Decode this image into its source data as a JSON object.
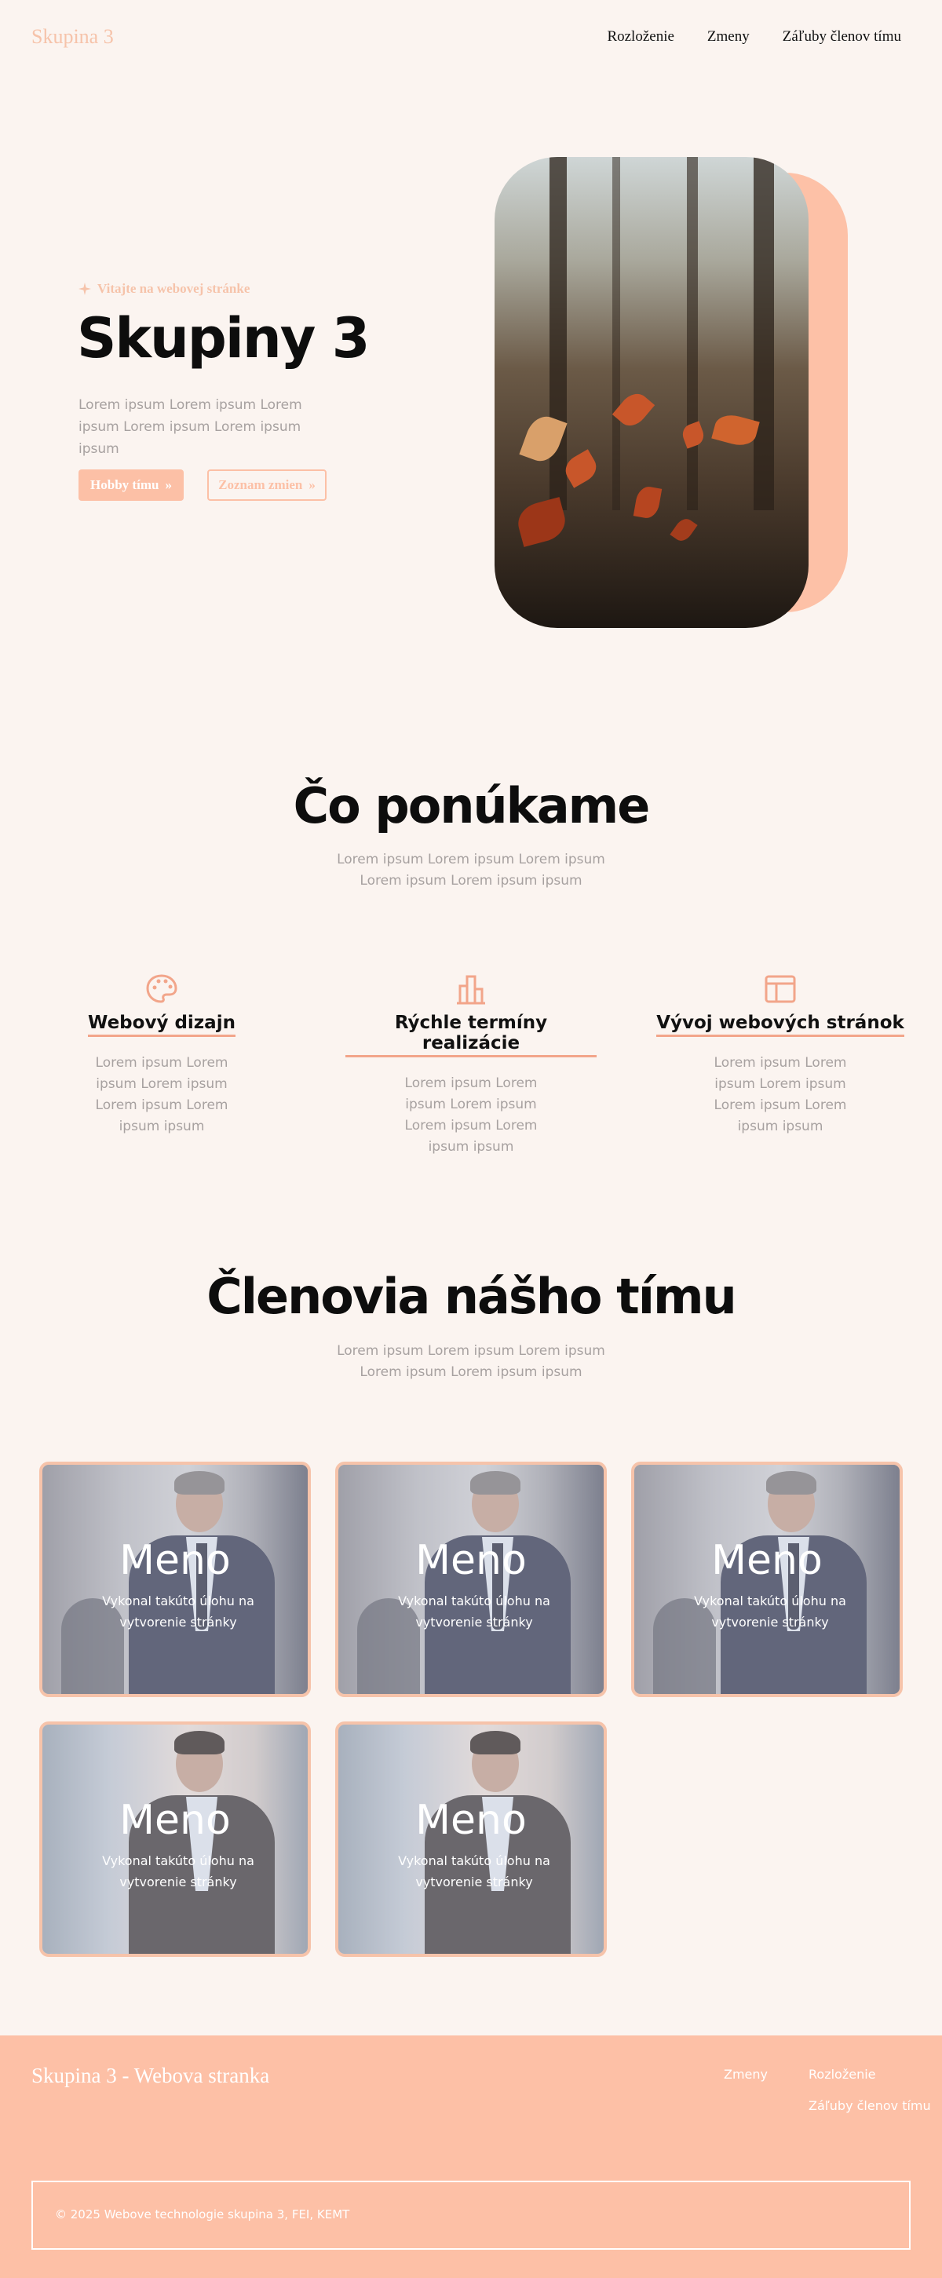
{
  "nav": {
    "logo": "Skupina 3",
    "links": [
      "Rozloženie",
      "Zmeny",
      "Záľuby členov tímu"
    ]
  },
  "hero": {
    "eyebrow": "Vitajte na webovej stránke",
    "title": "Skupiny 3",
    "text": "Lorem ipsum Lorem ipsum Lorem ipsum Lorem ipsum Lorem ipsum ipsum",
    "primary_button": "Hobby tímu",
    "secondary_button": "Zoznam zmien",
    "accent_color": "#fcc0a6"
  },
  "offer": {
    "title": "Čo ponúkame",
    "subtitle": "Lorem ipsum Lorem ipsum Lorem ipsum Lorem ipsum Lorem ipsum ipsum",
    "features": [
      {
        "icon": "palette-icon",
        "title": "Webový dizajn",
        "text": "Lorem ipsum Lorem ipsum Lorem ipsum Lorem ipsum Lorem ipsum ipsum"
      },
      {
        "icon": "buildings-icon",
        "title": "Rýchle termíny realizácie",
        "text": "Lorem ipsum Lorem ipsum Lorem ipsum Lorem ipsum Lorem ipsum ipsum"
      },
      {
        "icon": "layout-icon",
        "title": "Vývoj webových stránok",
        "text": "Lorem ipsum Lorem ipsum Lorem ipsum Lorem ipsum Lorem ipsum ipsum"
      }
    ]
  },
  "team": {
    "title": "Členovia nášho tímu",
    "subtitle": "Lorem ipsum Lorem ipsum Lorem ipsum Lorem ipsum Lorem ipsum ipsum",
    "members": [
      {
        "name": "Meno",
        "desc": "Vykonal takúto úlohu na vytvorenie stránky"
      },
      {
        "name": "Meno",
        "desc": "Vykonal takúto úlohu na vytvorenie stránky"
      },
      {
        "name": "Meno",
        "desc": "Vykonal takúto úlohu na vytvorenie stránky"
      },
      {
        "name": "Meno",
        "desc": "Vykonal takúto úlohu na vytvorenie stránky"
      },
      {
        "name": "Meno",
        "desc": "Vykonal takúto úlohu na vytvorenie stránky"
      }
    ]
  },
  "footer": {
    "title": "Skupina 3 - Webova stranka",
    "links": [
      "Zmeny",
      "Rozloženie",
      "Záľuby členov tímu"
    ],
    "copyright": "© 2025 Webove technologie skupina 3, FEI, KEMT"
  }
}
